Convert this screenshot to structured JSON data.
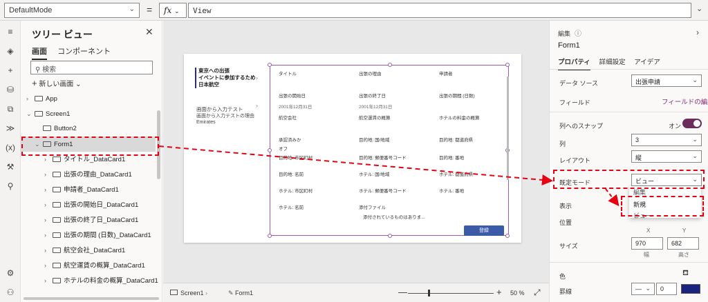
{
  "formula_bar": {
    "property": "DefaultMode",
    "fx": "fx",
    "formula": "View"
  },
  "tree": {
    "title": "ツリー ビュー",
    "tab_screens": "画面",
    "tab_components": "コンポーネント",
    "search_placeholder": "検索",
    "new_screen": "新しい画面",
    "items": [
      {
        "label": "App"
      },
      {
        "label": "Screen1"
      },
      {
        "label": "Button2"
      },
      {
        "label": "Form1"
      },
      {
        "label": "タイトル_DataCard1"
      },
      {
        "label": "出張の理由_DataCard1"
      },
      {
        "label": "申請者_DataCard1"
      },
      {
        "label": "出張の開始日_DataCard1"
      },
      {
        "label": "出張の終了日_DataCard1"
      },
      {
        "label": "出張の期間 (日数)_DataCard1"
      },
      {
        "label": "航空会社_DataCard1"
      },
      {
        "label": "航空運賃の概算_DataCard1"
      },
      {
        "label": "ホテルの料金の概算_DataCard1"
      }
    ]
  },
  "screen": {
    "nav1_title": "東京への出張",
    "nav1_sub1": "イベントに参加するため",
    "nav1_sub2": "日本航空",
    "nav2_title": "画面から入力テスト",
    "nav2_sub1": "画面から入力テストの理由",
    "nav2_sub2": "Emirates",
    "fields": {
      "f1": "タイトル",
      "f2": "出張の理由",
      "f3": "申請者",
      "f4": "出張の開始日",
      "f5": "出張の終了日",
      "f6": "出張の期間 (日数)",
      "v4": "2001年12月31日",
      "v5": "2001年12月31日",
      "f7": "航空会社",
      "f8": "航空運賃の概算",
      "f9": "ホテルの料金の概算",
      "f10": "承認済みか",
      "v10": "オフ",
      "f11": "目的地: 国/地域",
      "f12": "目的地: 都道府県",
      "f13": "目的地: 市区町村",
      "f14": "目的地: 郵便番号コード",
      "f15": "目的地: 番地",
      "f16": "目的地: 名前",
      "f17": "ホテル: 国/地域",
      "f18": "ホテル: 都道府県",
      "f19": "ホテル: 市区町村",
      "f20": "ホテル: 郵便番号コード",
      "f21": "ホテル: 番地",
      "f22": "ホテル: 名前",
      "f23": "添付ファイル",
      "v23": "添付されているものはありま..."
    },
    "submit": "登録"
  },
  "status": {
    "screen": "Screen1",
    "form": "Form1",
    "zoom": "50",
    "zoom_unit": "%",
    "minus": "—",
    "plus": "+"
  },
  "props": {
    "edit": "編集",
    "name": "Form1",
    "tab_properties": "プロパティ",
    "tab_advanced": "詳細設定",
    "tab_ideas": "アイデア",
    "datasource_label": "データ ソース",
    "datasource_value": "出張申請",
    "fields_label": "フィールド",
    "fields_link": "フィールドの編集",
    "snap_label": "列へのスナップ",
    "snap_value": "オン",
    "columns_label": "列",
    "columns_value": "3",
    "layout_label": "レイアウト",
    "layout_value": "縦",
    "defaultmode_label": "既定モード",
    "defaultmode_value": "ビュー",
    "display_label": "表示",
    "position_label": "位置",
    "x_label": "X",
    "y_label": "Y",
    "size_label": "サイズ",
    "width_value": "970",
    "height_value": "682",
    "width_label": "幅",
    "height_label": "高さ",
    "color_label": "色",
    "border_label": "罫線",
    "border_value": "0",
    "colors": {
      "toggle": "#6b2c5c",
      "link": "#8a2b78",
      "border_swatch": "#1a237e"
    }
  },
  "dropdown_popup": {
    "opt_edit": "編集",
    "opt_new": "新規",
    "opt_view": "ビュー"
  }
}
